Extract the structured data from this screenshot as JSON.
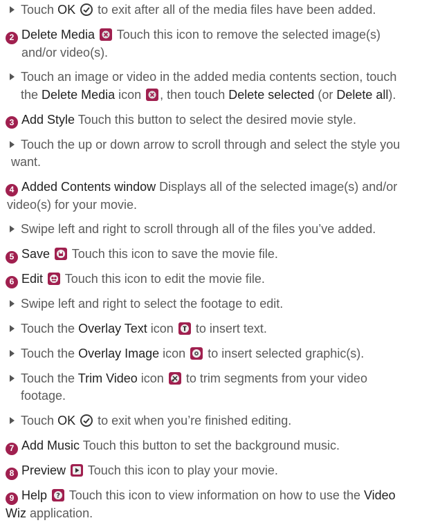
{
  "colors": {
    "accent": "#a0204f",
    "text": "#5a5a5a",
    "bold": "#222222"
  },
  "r1": {
    "a": "Touch",
    "b": "OK",
    "c": "to exit after all of the media files have been added."
  },
  "r2": {
    "num": "2",
    "b": "Delete Media",
    "c": "Touch this icon to remove the selected image(s)",
    "d": "and/or video(s)."
  },
  "r3": {
    "a": "Touch an image or video in the added media contents section, touch",
    "b": "the",
    "c": "Delete Media",
    "d": "icon",
    "e": ", then touch",
    "f": "Delete selected",
    "g": "(or",
    "h": "Delete all",
    "i": ")."
  },
  "r4": {
    "num": "3",
    "b": "Add Style",
    "c": "Touch this button to select the desired movie style."
  },
  "r5": {
    "a": "Touch the up or down arrow to scroll through and select the style you",
    "b": "want."
  },
  "r6": {
    "num": "4",
    "b": "Added Contents window",
    "c": "Displays all of the selected image(s) and/or",
    "d": "video(s) for your movie."
  },
  "r7": {
    "a": "Swipe left and right to scroll through all of the files you’ve added."
  },
  "r8": {
    "num": "5",
    "b": "Save",
    "c": "Touch this icon to save the movie file."
  },
  "r9": {
    "num": "6",
    "b": "Edit",
    "c": "Touch this icon to edit the movie file."
  },
  "r10": {
    "a": "Swipe left and right to select the footage to edit."
  },
  "r11": {
    "a": "Touch the",
    "b": "Overlay Text",
    "c": "icon",
    "d": "to insert text."
  },
  "r12": {
    "a": "Touch the",
    "b": "Overlay Image",
    "c": "icon",
    "d": "to insert selected graphic(s)."
  },
  "r13": {
    "a": "Touch the",
    "b": "Trim Video",
    "c": "icon",
    "d": "to trim segments from your video",
    "e": "footage."
  },
  "r14": {
    "a": "Touch",
    "b": "OK",
    "c": "to exit when you’re finished editing."
  },
  "r15": {
    "num": "7",
    "b": "Add Music",
    "c": "Touch this button to set the background music."
  },
  "r16": {
    "num": "8",
    "b": "Preview",
    "c": "Touch this icon to play your movie."
  },
  "r17": {
    "num": "9",
    "b": "Help",
    "c": "Touch this icon to view information on how to use the",
    "d": "Video",
    "e": "Wiz",
    "f": "application."
  },
  "icons": [
    "check-circle-icon",
    "delete-media-icon",
    "save-icon",
    "edit-icon",
    "overlay-text-icon",
    "overlay-image-icon",
    "trim-video-icon",
    "play-icon",
    "help-icon"
  ]
}
